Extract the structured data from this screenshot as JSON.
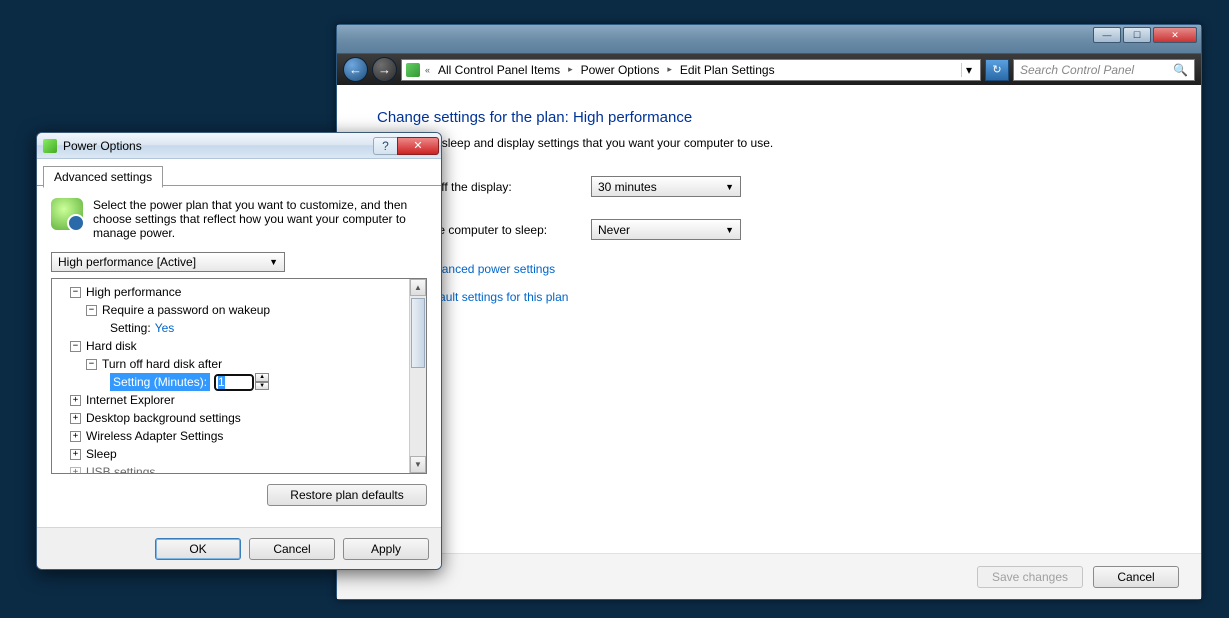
{
  "cp_window": {
    "breadcrumb": {
      "prefix_glyph": "«",
      "items": [
        "All Control Panel Items",
        "Power Options",
        "Edit Plan Settings"
      ]
    },
    "search_placeholder": "Search Control Panel",
    "heading": "Change settings for the plan: High performance",
    "subtext": "Choose the sleep and display settings that you want your computer to use.",
    "rows": {
      "display": {
        "label": "Turn off the display:",
        "value": "30 minutes"
      },
      "sleep": {
        "label": "Put the computer to sleep:",
        "value": "Never"
      }
    },
    "links": {
      "advanced": "Change advanced power settings",
      "restore": "Restore default settings for this plan"
    },
    "buttons": {
      "save": "Save changes",
      "cancel": "Cancel"
    }
  },
  "dialog": {
    "title": "Power Options",
    "tab": "Advanced settings",
    "intro": "Select the power plan that you want to customize, and then choose settings that reflect how you want your computer to manage power.",
    "plan_selector": "High performance [Active]",
    "tree": {
      "n0": "High performance",
      "n0a": "Require a password on wakeup",
      "n0a_setting_label": "Setting:",
      "n0a_setting_value": "Yes",
      "n1": "Hard disk",
      "n1a": "Turn off hard disk after",
      "n1a_setting_label": "Setting (Minutes):",
      "n1a_setting_value": "1",
      "n2": "Internet Explorer",
      "n3": "Desktop background settings",
      "n4": "Wireless Adapter Settings",
      "n5": "Sleep",
      "n6": "USB settings"
    },
    "restore_defaults": "Restore plan defaults",
    "buttons": {
      "ok": "OK",
      "cancel": "Cancel",
      "apply": "Apply"
    }
  }
}
